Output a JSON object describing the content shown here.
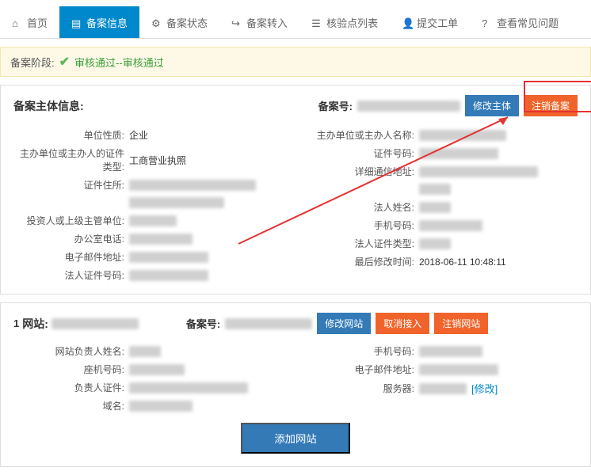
{
  "tabs": [
    {
      "label": "首页",
      "icon": "home"
    },
    {
      "label": "备案信息",
      "icon": "file",
      "active": true
    },
    {
      "label": "备案状态",
      "icon": "gear"
    },
    {
      "label": "备案转入",
      "icon": "arrow"
    },
    {
      "label": "核验点列表",
      "icon": "list"
    },
    {
      "label": "提交工单",
      "icon": "user"
    },
    {
      "label": "查看常见问题",
      "icon": "help"
    }
  ],
  "stage": {
    "label": "备案阶段:",
    "status": "审核通过--审核通过"
  },
  "subject": {
    "title": "备案主体信息:",
    "record_label": "备案号:",
    "btn_modify": "修改主体",
    "btn_cancel": "注销备案",
    "left_rows": [
      {
        "label": "单位性质:",
        "value": "企业"
      },
      {
        "label": "主办单位或主办人的证件类型:",
        "value": "工商营业执照"
      },
      {
        "label": "证件住所:",
        "blur": 160
      },
      {
        "label": "",
        "blur": 120
      },
      {
        "label": "投资人或上级主管单位:",
        "blur": 60
      },
      {
        "label": "办公室电话:",
        "blur": 80
      },
      {
        "label": "电子邮件地址:",
        "blur": 100
      },
      {
        "label": "法人证件号码:",
        "blur": 100
      }
    ],
    "right_rows": [
      {
        "label": "主办单位或主办人名称:",
        "blur": 110
      },
      {
        "label": "证件号码:",
        "blur": 100
      },
      {
        "label": "详细通信地址:",
        "blur": 150
      },
      {
        "label": "",
        "blur": 40
      },
      {
        "label": "法人姓名:",
        "blur": 40
      },
      {
        "label": "手机号码:",
        "blur": 80
      },
      {
        "label": "法人证件类型:",
        "blur": 40
      },
      {
        "label": "最后修改时间:",
        "value": "2018-06-11 10:48:11"
      }
    ]
  },
  "site": {
    "num": "1",
    "label": "网站:",
    "record_label": "备案号:",
    "btn_modify": "修改网站",
    "btn_cancel_access": "取消接入",
    "btn_cancel_site": "注销网站",
    "link_modify": "[修改]",
    "btn_add": "添加网站",
    "left_rows": [
      {
        "label": "网站负责人姓名:",
        "blur": 40
      },
      {
        "label": "座机号码:",
        "blur": 70
      },
      {
        "label": "负责人证件:",
        "blur": 150
      },
      {
        "label": "域名:",
        "blur": 80
      }
    ],
    "right_rows": [
      {
        "label": "手机号码:",
        "blur": 80
      },
      {
        "label": "电子邮件地址:",
        "blur": 100
      },
      {
        "label": "服务器:",
        "blur": 60,
        "link": true
      }
    ]
  }
}
